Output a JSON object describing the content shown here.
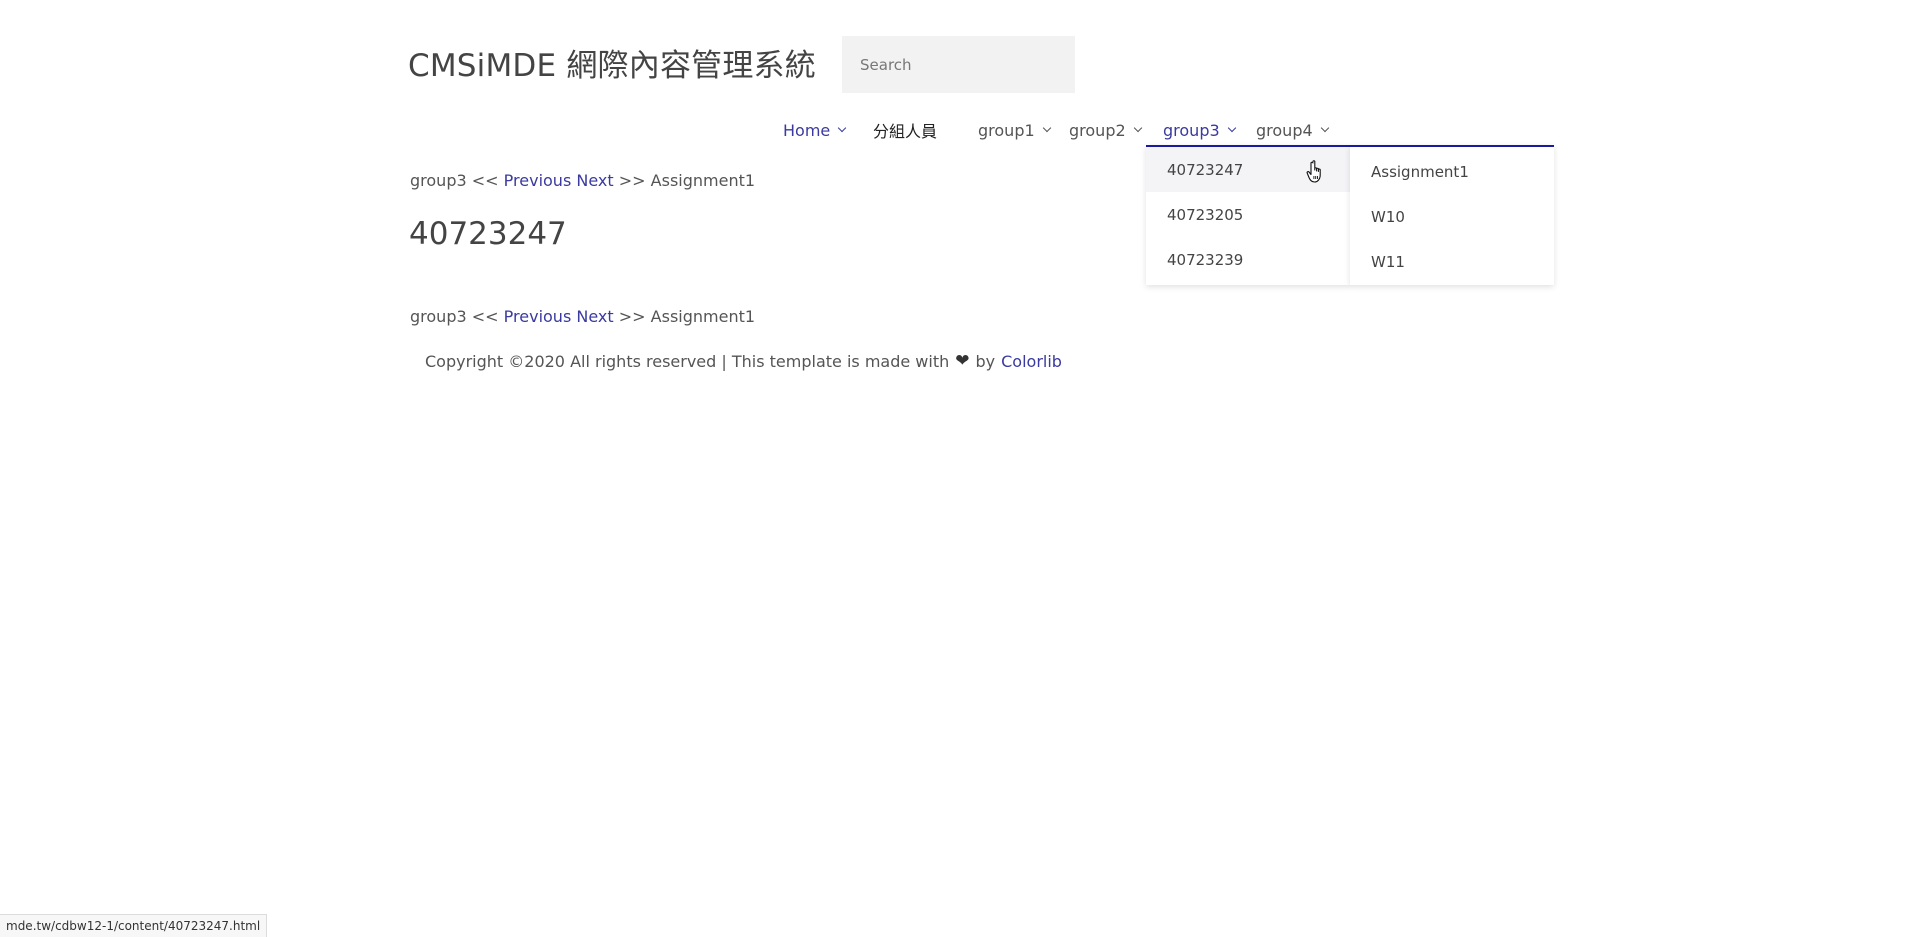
{
  "header": {
    "site_title": "CMSiMDE 網際內容管理系統",
    "search_placeholder": "Search"
  },
  "nav": {
    "items": [
      {
        "label": "Home",
        "has_dropdown": true
      },
      {
        "label": "分組人員",
        "has_dropdown": false
      },
      {
        "label": "group1",
        "has_dropdown": true
      },
      {
        "label": "group2",
        "has_dropdown": true
      },
      {
        "label": "group3",
        "has_dropdown": true,
        "active": true
      },
      {
        "label": "group4",
        "has_dropdown": true
      }
    ]
  },
  "dropdown_members": {
    "items": [
      "40723247",
      "40723205",
      "40723239"
    ],
    "hovered": "40723247"
  },
  "dropdown_pages": {
    "items": [
      "Assignment1",
      "W10",
      "W11"
    ]
  },
  "breadcrumb": {
    "group": "group3",
    "left_arrows": "<<",
    "previous": "Previous",
    "next": "Next",
    "right_arrows": ">>",
    "target": "Assignment1"
  },
  "main": {
    "heading": "40723247"
  },
  "footer": {
    "text_before": "Copyright ©2020 All rights reserved | This template is made with",
    "heart_icon": "heart-icon",
    "text_by": "by",
    "link": "Colorlib"
  },
  "status_bar": {
    "url": "mde.tw/cdbw12-1/content/40723247.html"
  },
  "colors": {
    "accent": "#3a3aa0",
    "dropdown_border": "#1a1aa0",
    "search_bg": "#f2f2f2",
    "hover_bg": "#f4f4f7"
  }
}
